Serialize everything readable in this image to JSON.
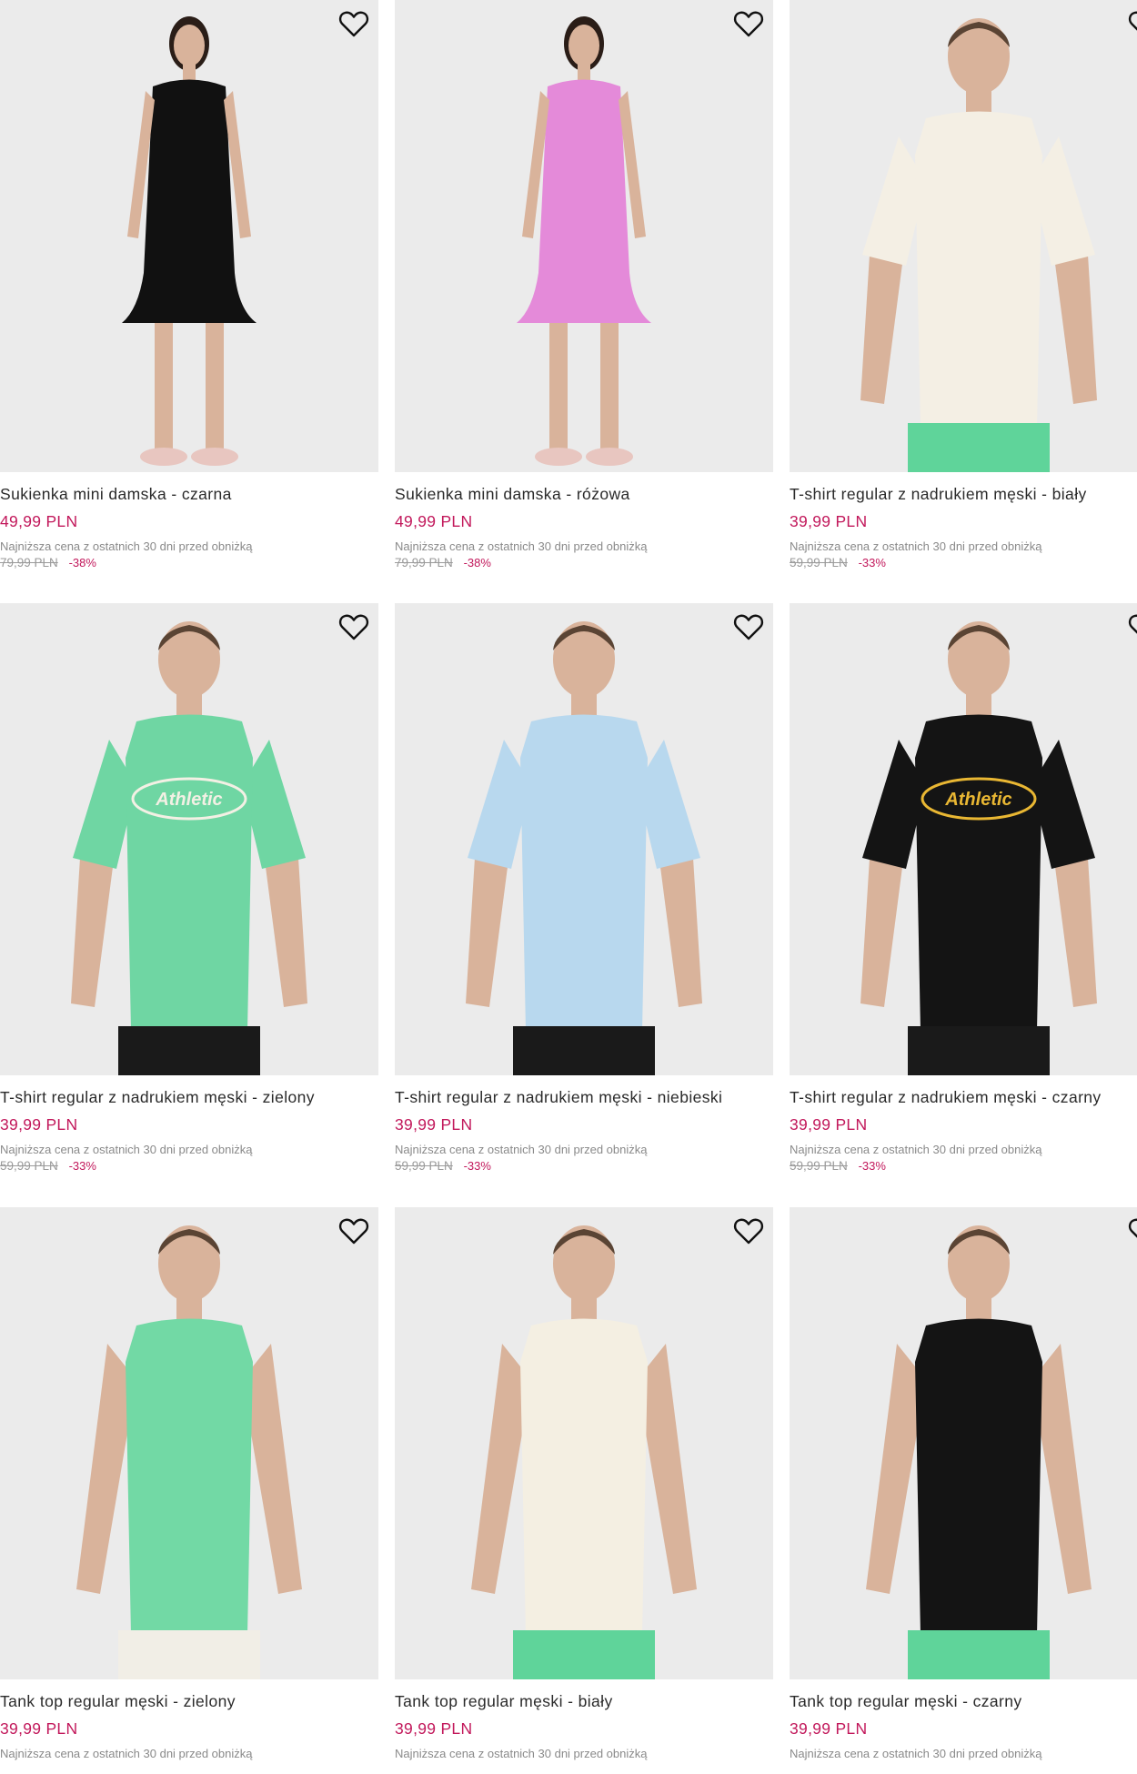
{
  "products": [
    {
      "name": "Sukienka mini damska - czarna",
      "price": "49,99 PLN",
      "lowest_label": "Najniższa cena z ostatnich 30 dni przed obniżką",
      "old_price": "79,99 PLN",
      "discount": "-38%",
      "garment_color": "#111111",
      "garment": "dress"
    },
    {
      "name": "Sukienka mini damska - różowa",
      "price": "49,99 PLN",
      "lowest_label": "Najniższa cena z ostatnich 30 dni przed obniżką",
      "old_price": "79,99 PLN",
      "discount": "-38%",
      "garment_color": "#e48ad9",
      "garment": "dress"
    },
    {
      "name": "T-shirt regular z nadrukiem męski - biały",
      "price": "39,99 PLN",
      "lowest_label": "Najniższa cena z ostatnich 30 dni przed obniżką",
      "old_price": "59,99 PLN",
      "discount": "-33%",
      "garment_color": "#f4efe4",
      "garment": "tshirt"
    },
    {
      "name": "T-shirt regular z nadrukiem męski - zielony",
      "price": "39,99 PLN",
      "lowest_label": "Najniższa cena z ostatnich 30 dni przed obniżką",
      "old_price": "59,99 PLN",
      "discount": "-33%",
      "garment_color": "#6fd6a3",
      "garment": "tshirt",
      "print_text": "Athletic"
    },
    {
      "name": "T-shirt regular z nadrukiem męski - niebieski",
      "price": "39,99 PLN",
      "lowest_label": "Najniższa cena z ostatnich 30 dni przed obniżką",
      "old_price": "59,99 PLN",
      "discount": "-33%",
      "garment_color": "#b8d8ee",
      "garment": "tshirt"
    },
    {
      "name": "T-shirt regular z nadrukiem męski - czarny",
      "price": "39,99 PLN",
      "lowest_label": "Najniższa cena z ostatnich 30 dni przed obniżką",
      "old_price": "59,99 PLN",
      "discount": "-33%",
      "garment_color": "#141414",
      "garment": "tshirt",
      "print_text": "Athletic"
    },
    {
      "name": "Tank top regular męski - zielony",
      "price": "39,99 PLN",
      "lowest_label": "Najniższa cena z ostatnich 30 dni przed obniżką",
      "garment_color": "#72d9a5",
      "garment": "tank"
    },
    {
      "name": "Tank top regular męski - biały",
      "price": "39,99 PLN",
      "lowest_label": "Najniższa cena z ostatnich 30 dni przed obniżką",
      "garment_color": "#f4efe2",
      "garment": "tank"
    },
    {
      "name": "Tank top regular męski - czarny",
      "price": "39,99 PLN",
      "lowest_label": "Najniższa cena z ostatnich 30 dni przed obniżką",
      "garment_color": "#141414",
      "garment": "tank"
    }
  ],
  "icons": {
    "favorite": "heart-outline-icon"
  },
  "colors": {
    "accent": "#c2185b",
    "image_bg": "#ebebeb"
  }
}
